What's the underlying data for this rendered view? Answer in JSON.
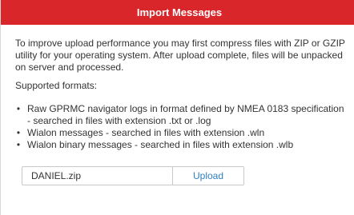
{
  "dialog": {
    "title": "Import Messages",
    "intro": "To improve upload performance you may first compress files with ZIP or GZIP utility for your operating system. After upload complete, files will be unpacked on server and processed.",
    "supported_label": "Supported formats:",
    "formats": [
      "Raw GPRMC navigator logs in format defined by NMEA 0183 specification - searched in files with extension .txt or .log",
      "Wialon messages - searched in files with extension .wln",
      "Wialon binary messages - searched in files with extension .wlb"
    ],
    "bullet": "•",
    "file": {
      "name": "DANIEL.zip",
      "upload_label": "Upload"
    }
  },
  "colors": {
    "titlebar": "#d9262a",
    "link": "#2d7fc1"
  }
}
